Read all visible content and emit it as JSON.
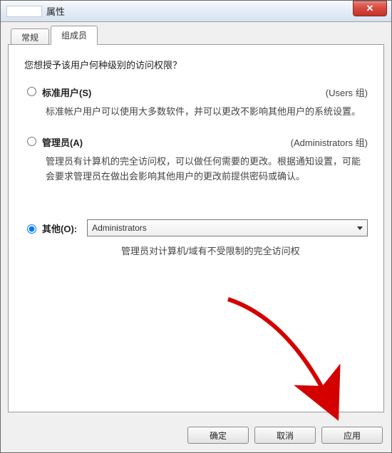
{
  "window": {
    "title_suffix": "属性",
    "close_glyph": "✕"
  },
  "tabs": {
    "general": "常规",
    "members": "组成员"
  },
  "prompt": "您想授予该用户何种级别的访问权限？",
  "options": {
    "standard": {
      "label": "标准用户(S)",
      "group": "(Users 组)",
      "desc": "标准帐户用户可以使用大多数软件，并可以更改不影响其他用户的系统设置。"
    },
    "admin": {
      "label": "管理员(A)",
      "group": "(Administrators 组)",
      "desc": "管理员有计算机的完全访问权，可以做任何需要的更改。根据通知设置，可能会要求管理员在做出会影响其他用户的更改前提供密码或确认。"
    },
    "other": {
      "label": "其他(O):",
      "selected_value": "Administrators",
      "desc": "管理员对计算机/域有不受限制的完全访问权"
    }
  },
  "buttons": {
    "ok": "确定",
    "cancel": "取消",
    "apply": "应用"
  }
}
